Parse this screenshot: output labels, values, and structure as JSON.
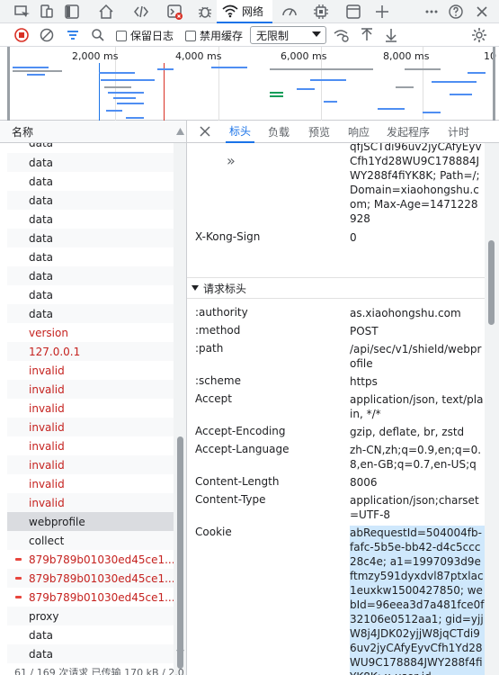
{
  "topbar": {
    "network_tab_label": "网络",
    "icons": [
      "device-toolbar-icon",
      "inspect-icon",
      "dock-icon",
      "home-icon",
      "sources-icon",
      "console-icon",
      "bug-icon",
      "wifi-icon",
      "performance-icon",
      "cpu-icon",
      "application-icon",
      "add-icon",
      "more-icon",
      "help-icon",
      "close-icon"
    ]
  },
  "toolbar": {
    "preserve_log_label": "保留日志",
    "disable_cache_label": "禁用缓存",
    "throttle_value": "无限制"
  },
  "overview": {
    "ticks": [
      "2,000 ms",
      "4,000 ms",
      "6,000 ms",
      "8,000 ms",
      "10"
    ]
  },
  "requests": {
    "column_name": "名称",
    "first_partial": "data",
    "items": [
      {
        "name": "data",
        "status": "ok"
      },
      {
        "name": "data",
        "status": "ok"
      },
      {
        "name": "data",
        "status": "ok"
      },
      {
        "name": "data",
        "status": "ok"
      },
      {
        "name": "data",
        "status": "ok"
      },
      {
        "name": "data",
        "status": "ok"
      },
      {
        "name": "data",
        "status": "ok"
      },
      {
        "name": "data",
        "status": "ok"
      },
      {
        "name": "data",
        "status": "ok"
      },
      {
        "name": "version",
        "status": "error"
      },
      {
        "name": "127.0.0.1",
        "status": "error"
      },
      {
        "name": "invalid",
        "status": "error"
      },
      {
        "name": "invalid",
        "status": "error"
      },
      {
        "name": "invalid",
        "status": "error"
      },
      {
        "name": "invalid",
        "status": "error"
      },
      {
        "name": "invalid",
        "status": "error"
      },
      {
        "name": "invalid",
        "status": "error"
      },
      {
        "name": "invalid",
        "status": "error"
      },
      {
        "name": "invalid",
        "status": "error"
      },
      {
        "name": "webprofile",
        "status": "selected"
      },
      {
        "name": "collect",
        "status": "ok"
      },
      {
        "name": "879b789b01030ed45ce1...",
        "status": "failed"
      },
      {
        "name": "879b789b01030ed45ce1...",
        "status": "failed"
      },
      {
        "name": "879b789b01030ed45ce1...",
        "status": "failed"
      },
      {
        "name": "proxy",
        "status": "ok"
      },
      {
        "name": "data",
        "status": "ok"
      },
      {
        "name": "data",
        "status": "ok"
      }
    ],
    "status_text": "61 / 169 次请求   已传输 170 kB / 2.0"
  },
  "detail": {
    "tabs": [
      "标头",
      "负载",
      "预览",
      "响应",
      "发起程序",
      "计时"
    ],
    "active_tab": "标头",
    "cookie_tail": "qfjSCTdi96uv2jyCAfyEyvCfh1Yd28WU9C178884JWY288f4fiYK8K; Path=/; Domain=xiaohongshu.com; Max-Age=1471228928",
    "response_headers": [
      {
        "name": "X-Kong-Sign",
        "value": "0"
      }
    ],
    "request_section_title": "请求标头",
    "request_headers": [
      {
        "name": ":authority",
        "value": "as.xiaohongshu.com"
      },
      {
        "name": ":method",
        "value": "POST"
      },
      {
        "name": ":path",
        "value": "/api/sec/v1/shield/webprofile"
      },
      {
        "name": ":scheme",
        "value": "https"
      },
      {
        "name": "Accept",
        "value": "application/json, text/plain, */*"
      },
      {
        "name": "Accept-Encoding",
        "value": "gzip, deflate, br, zstd"
      },
      {
        "name": "Accept-Language",
        "value": "zh-CN,zh;q=0.9,en;q=0.8,en-GB;q=0.7,en-US;q=0.6"
      },
      {
        "name": "Content-Length",
        "value": "8006"
      },
      {
        "name": "Content-Type",
        "value": "application/json;charset=UTF-8"
      },
      {
        "name": "Cookie",
        "value": "abRequestId=504004fb-fafc-5b5e-bb42-d4c5ccc28c4e; a1=1997093d9eftmzy591dyxdvl87ptxlac1euxkw1500427850; webId=96eea3d7a481fce0f32106e0512aa1; gid=yjjW8j4JDK02yjjW8jqCTdi96uv2jyCAfyEyvCfh1Yd28WU9C178884JWY288f4fiYK8K; x-user-id-"
      }
    ]
  },
  "colors": {
    "accent": "#1a73e8",
    "error": "#c5221f",
    "selected_row": "#dadce0",
    "cookie_highlight": "#cfe8fc"
  }
}
